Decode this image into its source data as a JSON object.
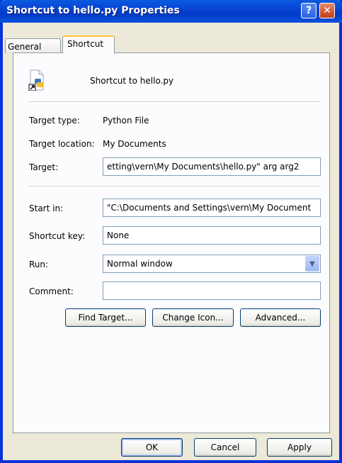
{
  "window": {
    "title": "Shortcut to hello.py Properties",
    "help_label": "?",
    "close_label": "✕"
  },
  "tabs": [
    {
      "label": "General",
      "selected": false
    },
    {
      "label": "Shortcut",
      "selected": true
    }
  ],
  "header": {
    "icon": "python-shortcut-icon",
    "name": "Shortcut to hello.py"
  },
  "fields": {
    "target_type_label": "Target type:",
    "target_type_value": "Python File",
    "target_location_label": "Target location:",
    "target_location_value": "My Documents",
    "target_label": "Target:",
    "target_value": "etting\\vern\\My Documents\\hello.py\" arg arg2",
    "start_in_label": "Start in:",
    "start_in_value": "\"C:\\Documents and Settings\\vern\\My Document",
    "shortcut_key_label": "Shortcut key:",
    "shortcut_key_value": "None",
    "run_label": "Run:",
    "run_value": "Normal window",
    "comment_label": "Comment:",
    "comment_value": ""
  },
  "actions": {
    "find_target": "Find Target...",
    "change_icon": "Change Icon...",
    "advanced": "Advanced..."
  },
  "footer": {
    "ok": "OK",
    "cancel": "Cancel",
    "apply": "Apply"
  },
  "colors": {
    "titlebar": "#0843d3",
    "close": "#c13d17",
    "tab_highlight": "#ffc83c"
  }
}
